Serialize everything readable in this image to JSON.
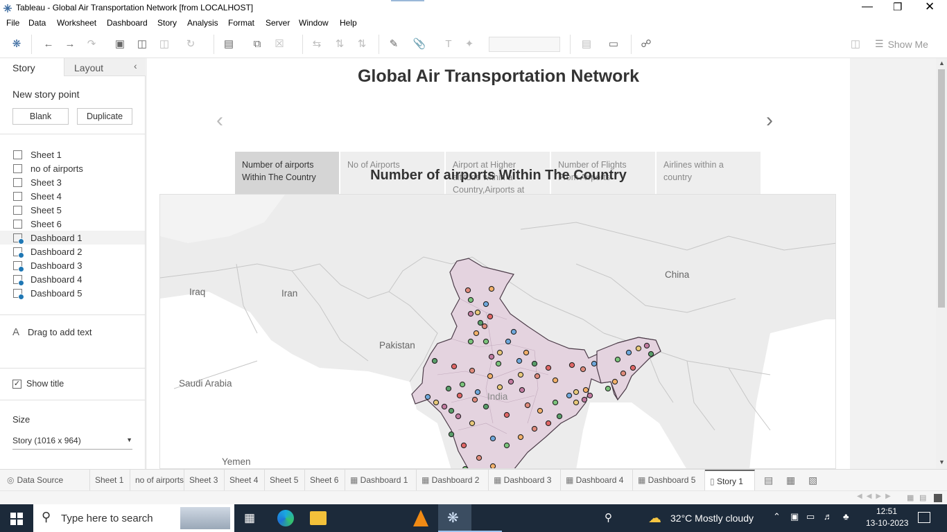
{
  "window": {
    "title": "Tableau - Global Air Transportation Network [from LOCALHOST]"
  },
  "menu": [
    "File",
    "Data",
    "Worksheet",
    "Dashboard",
    "Story",
    "Analysis",
    "Format",
    "Server",
    "Window",
    "Help"
  ],
  "toolbar": {
    "show_me": "Show Me"
  },
  "left_panel": {
    "tabs": {
      "story": "Story",
      "layout": "Layout"
    },
    "new_story_point": "New story point",
    "blank_button": "Blank",
    "duplicate_button": "Duplicate",
    "sheets": [
      {
        "label": "Sheet 1",
        "type": "sheet"
      },
      {
        "label": "no of airports",
        "type": "sheet"
      },
      {
        "label": "Sheet 3",
        "type": "sheet"
      },
      {
        "label": "Sheet 4",
        "type": "sheet"
      },
      {
        "label": "Sheet 5",
        "type": "sheet"
      },
      {
        "label": "Sheet 6",
        "type": "sheet"
      },
      {
        "label": "Dashboard 1",
        "type": "dashboard"
      },
      {
        "label": "Dashboard 2",
        "type": "dashboard"
      },
      {
        "label": "Dashboard 3",
        "type": "dashboard"
      },
      {
        "label": "Dashboard 4",
        "type": "dashboard"
      },
      {
        "label": "Dashboard 5",
        "type": "dashboard"
      }
    ],
    "drag_text": "Drag to add text",
    "show_title": "Show title",
    "show_title_checked": true,
    "size_heading": "Size",
    "size_value": "Story (1016 x 964)"
  },
  "story": {
    "title": "Global Air Transportation Network",
    "points": [
      "Number of airports Within The Country",
      "No of Airports",
      "Airport at Higher altitude within a Country,Airports at",
      "Number of Flights From Airports",
      "Airlines within a country"
    ],
    "active_point": 0,
    "sheet_title": "Number of airports Within The Country",
    "map_labels": {
      "iraq": "Iraq",
      "iran": "Iran",
      "pakistan": "Pakistan",
      "china": "China",
      "saudi": "Saudi Arabia",
      "india": "India",
      "yemen": "Yemen"
    }
  },
  "tabs": {
    "data_source": "Data Source",
    "items": [
      "Sheet 1",
      "no of airports",
      "Sheet 3",
      "Sheet 4",
      "Sheet 5",
      "Sheet 6",
      "Dashboard 1",
      "Dashboard 2",
      "Dashboard 3",
      "Dashboard 4",
      "Dashboard 5",
      "Story 1"
    ],
    "active": "Story 1"
  },
  "taskbar": {
    "search_placeholder": "Type here to search",
    "weather": "32°C  Mostly cloudy",
    "time": "12:51",
    "date": "13-10-2023"
  },
  "colors": {
    "accent": "#1f77b4",
    "country_fill": "#e5d5e0",
    "taskbar": "#1c2a3a"
  }
}
